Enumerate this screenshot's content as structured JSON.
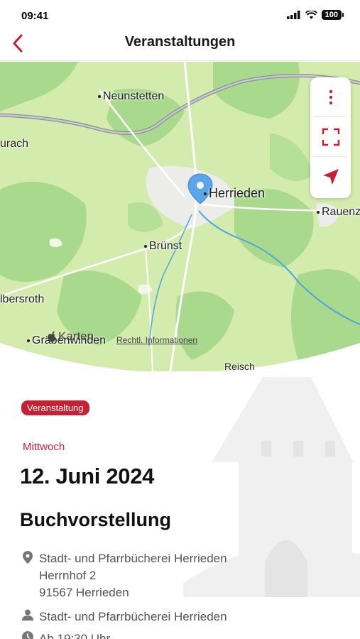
{
  "status_bar": {
    "time": "09:41",
    "battery": "100"
  },
  "nav": {
    "title": "Veranstaltungen",
    "back_icon": "chevron-left-icon"
  },
  "map": {
    "places": {
      "neunstetten": "Neunstetten",
      "urach": "urach",
      "herrieden": "Herrieden",
      "rauenzell": "Rauenz",
      "bruenst": "Brünst",
      "elbersroth": "lbersroth",
      "grafenwinden": "Gräbenwinden",
      "reisch": "Reisch"
    },
    "controls": [
      "more-icon",
      "fullscreen-icon",
      "location-arrow-icon"
    ],
    "attribution": "Karten",
    "legal": "Rechtl. Informationen"
  },
  "event": {
    "badge": "Veranstaltung",
    "weekday": "Mittwoch",
    "date": "12. Juni 2024",
    "title": "Buchvorstellung",
    "address": {
      "line1": "Stadt- und Pfarrbücherei Herrieden",
      "line2": "Herrnhof 2",
      "line3": "91567 Herrieden"
    },
    "organizer": "Stadt- und Pfarrbücherei Herrieden",
    "time": "Ab 19:30 Uhr"
  },
  "colors": {
    "accent": "#c62034",
    "map_green": "#cfe8a7",
    "forest": "#a8d88a",
    "water": "#4aa8e0",
    "pin": "#5aa6e8"
  }
}
